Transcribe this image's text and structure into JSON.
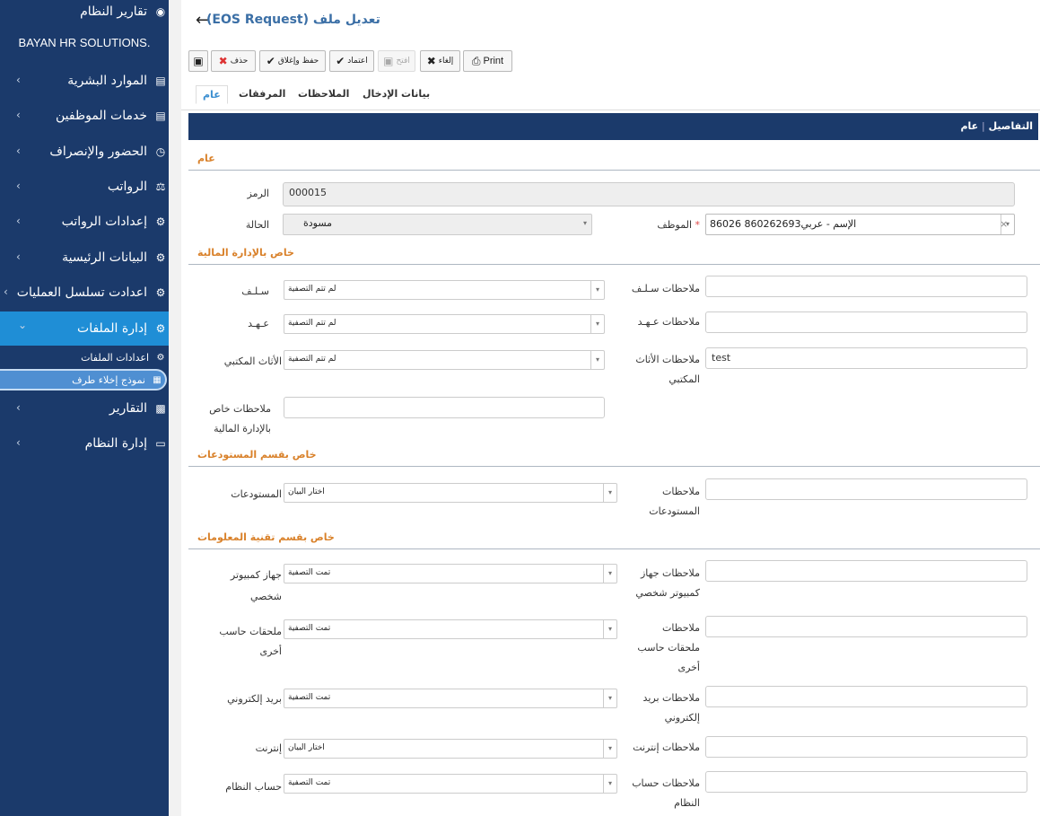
{
  "sidebar": {
    "brand": "BAYAN HR SOLUTIONS.",
    "items": [
      {
        "label": "تقارير النظام",
        "icon": "dashboard-icon"
      },
      {
        "label": "الموارد البشرية",
        "icon": "id-card-icon"
      },
      {
        "label": "خدمات الموظفين",
        "icon": "id-card-icon"
      },
      {
        "label": "الحضور والإنصراف",
        "icon": "clock-icon"
      },
      {
        "label": "الرواتب",
        "icon": "scale-icon"
      },
      {
        "label": "إعدادات الرواتب",
        "icon": "cogs-icon"
      },
      {
        "label": "البيانات الرئيسية",
        "icon": "cogs-icon"
      },
      {
        "label": "اعدادت تسلسل العمليات",
        "icon": "cogs-icon"
      },
      {
        "label": "إدارة الملفات",
        "icon": "cogs-icon"
      },
      {
        "label": "التقارير",
        "icon": "bar-chart-icon"
      },
      {
        "label": "إدارة النظام",
        "icon": "monitor-icon"
      }
    ],
    "sub": [
      {
        "label": "اعدادات الملفات",
        "icon": "cogs-icon"
      },
      {
        "label": "نموذج إخلاء طرف",
        "icon": "table-icon"
      }
    ]
  },
  "header": {
    "title": "تعديل ملف (EOS Request)"
  },
  "toolbar": {
    "print": "Print",
    "cancel": "إلغاء",
    "open": "افتح",
    "approve": "اعتماد",
    "save_attach": "حفظ وإغلاق",
    "delete": "حذف"
  },
  "tabs": {
    "entry": "بيانات الإدخال",
    "notes": "الملاحظات",
    "attachments": "المرفقات",
    "general": "عام"
  },
  "bar": {
    "details": "التفاصيل",
    "sep": "|",
    "general": "عام"
  },
  "sections": {
    "general": "عام",
    "finance": "خاص بالإدارة المالية",
    "warehouse": "خاص بقسم المستودعات",
    "it": "خاص بقسم تقنية المعلومات"
  },
  "fields": {
    "code_label": "الرمز",
    "code_value": "000015",
    "status_label": "الحالة",
    "status_value": "مسودة",
    "employee_label": "الموظف",
    "employee_value": "86026 860262693الإسم - عربي",
    "advance_label": "سـلـف",
    "advance_value": "لم تتم التصفية",
    "advance_notes": "ملاحظات سـلـف",
    "custody_label": "عـهـد",
    "custody_value": "لم تتم التصفية",
    "custody_notes": "ملاحظات عـهـد",
    "furniture_label": "الأثاث المكتبي",
    "furniture_value": "لم تتم التصفية",
    "furniture_notes_1": "ملاحظات الأثاث",
    "furniture_notes_2": "المكتبي",
    "furniture_notes_value": "test",
    "finance_notes_1": "ملاحظات خاص",
    "finance_notes_2": "بالإدارة المالية",
    "warehouse_label": "المستودعات",
    "warehouse_value": "اختار البيان",
    "warehouse_notes_1": "ملاحظات",
    "warehouse_notes_2": "المستودعات",
    "pc_label_1": "جهاز كمبيوتر",
    "pc_label_2": "شخصي",
    "pc_value": "تمت التصفية",
    "pc_notes_1": "ملاحظات جهاز",
    "pc_notes_2": "كمبيوتر شخصي",
    "acc_label_1": "ملحقات حاسب",
    "acc_label_2": "أخرى",
    "acc_value": "تمت التصفية",
    "acc_notes_1": "ملاحظات",
    "acc_notes_2": "ملحقات حاسب",
    "acc_notes_3": "أخرى",
    "email_label": "بريد إلكتروني",
    "email_value": "تمت التصفية",
    "email_notes_1": "ملاحظات بريد",
    "email_notes_2": "إلكتروني",
    "internet_label": "إنترنت",
    "internet_value": "اختار البيان",
    "internet_notes": "ملاحظات إنترنت",
    "sysacc_label": "حساب النظام",
    "sysacc_value": "تمت التصفية",
    "sysacc_notes_1": "ملاحظات حساب",
    "sysacc_notes_2": "النظام"
  }
}
